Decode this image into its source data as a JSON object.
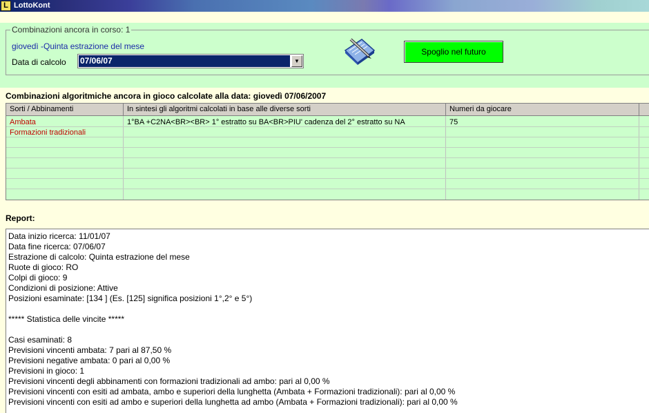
{
  "window": {
    "title": "LottoKont",
    "logo_letter": "L"
  },
  "panel": {
    "group_legend": "Combinazioni ancora in corso: 1",
    "day_text": "giovedì -Quinta  estrazione del mese",
    "date_label": "Data di calcolo",
    "date_value": "07/06/07",
    "spoglio_button": "Spoglio nel futuro",
    "colors": {
      "panel_bg": "#CCFFCC",
      "button_bg": "#00FF00",
      "selected_bg": "#0A246A"
    }
  },
  "section_title": "Combinazioni algoritmiche ancora in gioco calcolate alla data: giovedì 07/06/2007",
  "grid": {
    "columns": [
      "Sorti / Abbinamenti",
      "In sintesi gli algoritmi calcolati in base alle diverse sorti",
      "Numeri da giocare"
    ],
    "rows": [
      {
        "sorte": "Ambata",
        "sintesi": "1°BA +C2NA<BR><BR> 1° estratto su BA<BR>PIU' cadenza del 2° estratto su NA",
        "numeri": "75"
      },
      {
        "sorte": "Formazioni tradizionali",
        "sintesi": "",
        "numeri": ""
      }
    ]
  },
  "report": {
    "title": "Report:",
    "lines": [
      "Data inizio ricerca: 11/01/07",
      "Data fine ricerca: 07/06/07",
      "Estrazione di calcolo: Quinta estrazione del mese",
      "Ruote di gioco: RO",
      "Colpi di gioco: 9",
      "Condizioni di posizione: Attive",
      "Posizioni esaminate: [134 ] (Es. [125] significa posizioni 1°,2° e 5°)",
      "",
      "***** Statistica delle vincite *****",
      "",
      "Casi esaminati: 8",
      "Previsioni vincenti ambata: 7 pari al 87,50 %",
      "Previsioni negative ambata: 0 pari al 0,00 %",
      "Previsioni in gioco: 1",
      "Previsioni vincenti degli abbinamenti con formazioni tradizionali ad ambo:  pari al 0,00 %",
      "Previsioni vincenti con esiti ad ambata, ambo e superiori della lunghetta (Ambata + Formazioni tradizionali):  pari al 0,00 %",
      "Previsioni vincenti con esiti ad ambo e superiori della lunghetta ad ambo (Ambata + Formazioni tradizionali):  pari al 0,00 %"
    ]
  }
}
